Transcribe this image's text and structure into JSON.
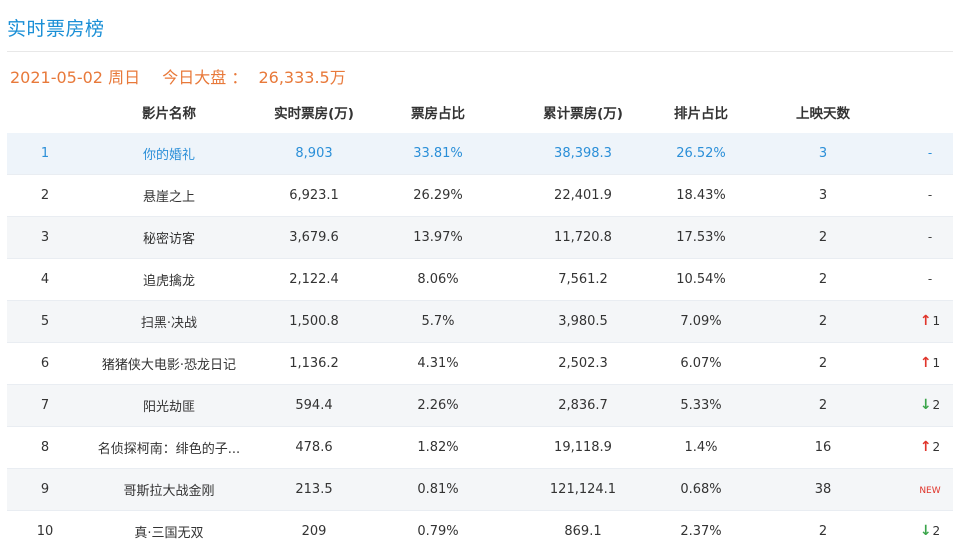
{
  "page": {
    "title": "实时票房榜",
    "date": "2021-05-02",
    "weekday": "周日",
    "total_label": "今日大盘 ：",
    "total_value": "26,333.5万"
  },
  "table": {
    "columns": [
      "影片名称",
      "实时票房(万)",
      "票房占比",
      "累计票房(万)",
      "排片占比",
      "上映天数"
    ],
    "rows": [
      {
        "rank": "1",
        "name": "你的婚礼",
        "box": "8,903",
        "share": "33.81%",
        "total": "38,398.3",
        "sched": "26.52%",
        "days": "3",
        "trend": "-",
        "trend_type": "none"
      },
      {
        "rank": "2",
        "name": "悬崖之上",
        "box": "6,923.1",
        "share": "26.29%",
        "total": "22,401.9",
        "sched": "18.43%",
        "days": "3",
        "trend": "-",
        "trend_type": "none"
      },
      {
        "rank": "3",
        "name": "秘密访客",
        "box": "3,679.6",
        "share": "13.97%",
        "total": "11,720.8",
        "sched": "17.53%",
        "days": "2",
        "trend": "-",
        "trend_type": "none"
      },
      {
        "rank": "4",
        "name": "追虎擒龙",
        "box": "2,122.4",
        "share": "8.06%",
        "total": "7,561.2",
        "sched": "10.54%",
        "days": "2",
        "trend": "-",
        "trend_type": "none"
      },
      {
        "rank": "5",
        "name": "扫黑·决战",
        "box": "1,500.8",
        "share": "5.7%",
        "total": "3,980.5",
        "sched": "7.09%",
        "days": "2",
        "trend": "1",
        "trend_type": "up"
      },
      {
        "rank": "6",
        "name": "猪猪侠大电影·恐龙日记",
        "box": "1,136.2",
        "share": "4.31%",
        "total": "2,502.3",
        "sched": "6.07%",
        "days": "2",
        "trend": "1",
        "trend_type": "up"
      },
      {
        "rank": "7",
        "name": "阳光劫匪",
        "box": "594.4",
        "share": "2.26%",
        "total": "2,836.7",
        "sched": "5.33%",
        "days": "2",
        "trend": "2",
        "trend_type": "down"
      },
      {
        "rank": "8",
        "name": "名侦探柯南：绯色的子...",
        "box": "478.6",
        "share": "1.82%",
        "total": "19,118.9",
        "sched": "1.4%",
        "days": "16",
        "trend": "2",
        "trend_type": "up"
      },
      {
        "rank": "9",
        "name": "哥斯拉大战金刚",
        "box": "213.5",
        "share": "0.81%",
        "total": "121,124.1",
        "sched": "0.68%",
        "days": "38",
        "trend": "NEW",
        "trend_type": "new"
      },
      {
        "rank": "10",
        "name": "真·三国无双",
        "box": "209",
        "share": "0.79%",
        "total": "869.1",
        "sched": "2.37%",
        "days": "2",
        "trend": "2",
        "trend_type": "down"
      }
    ]
  },
  "icons": {
    "up": "arrow-up-icon",
    "down": "arrow-down-icon"
  },
  "colors": {
    "title": "#1a8fd6",
    "date": "#e8793a",
    "highlight_row": "#2b8fd8",
    "up": "#e0352b",
    "down": "#3aa54a",
    "new": "#e0352b"
  }
}
